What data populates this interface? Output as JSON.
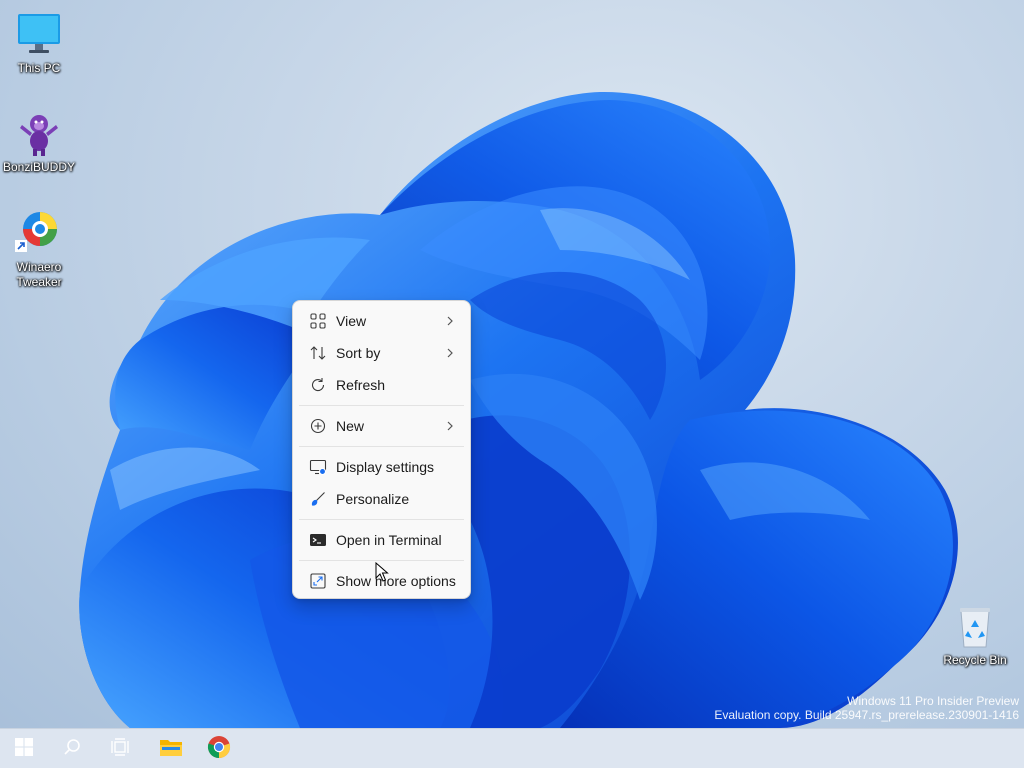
{
  "desktop": {
    "icons": [
      {
        "label": "This PC",
        "icon": "monitor-icon"
      },
      {
        "label": "BonziBUDDY",
        "icon": "purple-gorilla-icon"
      },
      {
        "label": "Winaero\nTweaker",
        "label_line1": "Winaero",
        "label_line2": "Tweaker",
        "icon": "winaero-tweaker-icon"
      },
      {
        "label": "Recycle Bin",
        "icon": "recycle-bin-icon"
      }
    ]
  },
  "context_menu": {
    "items": [
      {
        "label": "View",
        "icon": "grid-icon",
        "submenu": true
      },
      {
        "label": "Sort by",
        "icon": "sort-arrows-icon",
        "submenu": true
      },
      {
        "label": "Refresh",
        "icon": "refresh-icon",
        "submenu": false
      },
      {
        "label": "New",
        "icon": "plus-circle-icon",
        "submenu": true
      },
      {
        "label": "Display settings",
        "icon": "display-settings-icon",
        "submenu": false
      },
      {
        "label": "Personalize",
        "icon": "brush-icon",
        "submenu": false
      },
      {
        "label": "Open in Terminal",
        "icon": "terminal-icon",
        "submenu": false
      },
      {
        "label": "Show more options",
        "icon": "expand-icon",
        "submenu": false
      }
    ]
  },
  "watermark": {
    "line1": "Windows 11 Pro Insider Preview",
    "line2": "Evaluation copy. Build 25947.rs_prerelease.230901-1416"
  },
  "taskbar": {
    "buttons": [
      "start-icon",
      "search-icon",
      "task-view-icon",
      "file-explorer-icon",
      "chrome-icon"
    ]
  },
  "colors": {
    "bloom_dark": "#0a3fd6",
    "bloom_mid": "#1a6ef0",
    "bloom_light": "#5fb0ff",
    "menu_bg": "#f9f9f9",
    "taskbar_bg": "#dde5f0"
  }
}
